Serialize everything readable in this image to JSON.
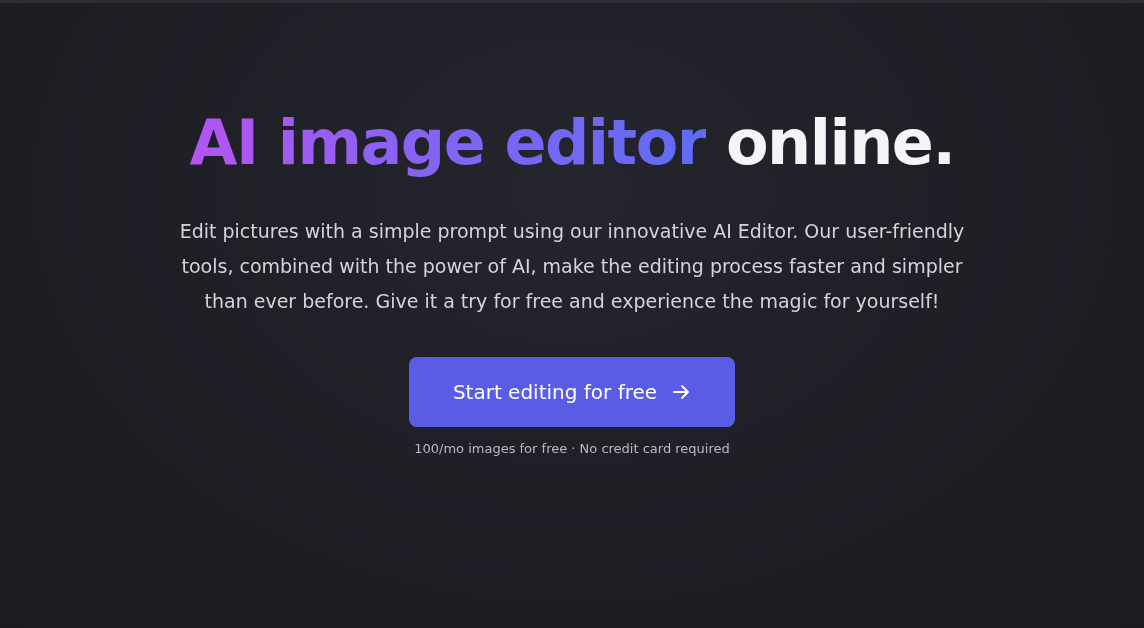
{
  "hero": {
    "title_highlight": "AI image editor",
    "title_rest": "online.",
    "description": "Edit pictures with a simple prompt using our innovative AI Editor. Our user-friendly tools, combined with the power of AI, make the editing process faster and simpler than ever before. Give it a try for free and experience the magic for yourself!",
    "cta": {
      "label": "Start editing for free"
    },
    "note": "100/mo images for free · No credit card required"
  }
}
